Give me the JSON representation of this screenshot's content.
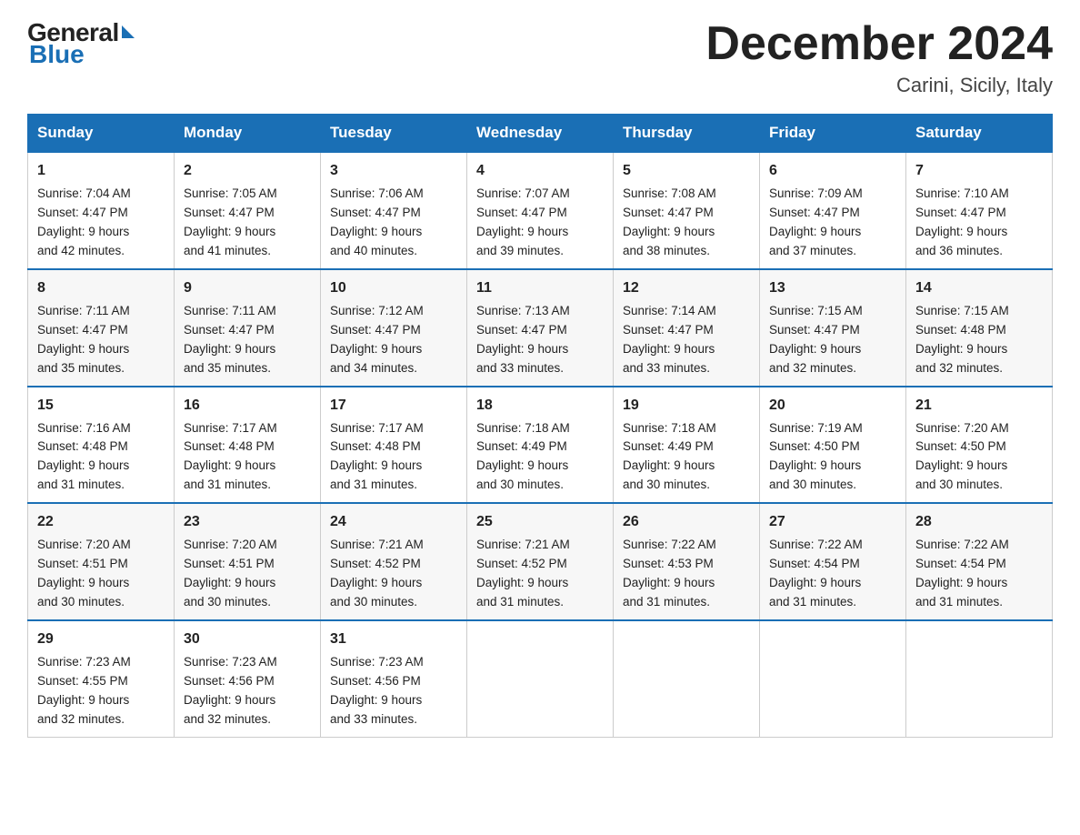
{
  "header": {
    "logo_general": "General",
    "logo_blue": "Blue",
    "month_title": "December 2024",
    "location": "Carini, Sicily, Italy"
  },
  "days_of_week": [
    "Sunday",
    "Monday",
    "Tuesday",
    "Wednesday",
    "Thursday",
    "Friday",
    "Saturday"
  ],
  "weeks": [
    [
      {
        "day": "1",
        "sunrise": "7:04 AM",
        "sunset": "4:47 PM",
        "daylight": "9 hours and 42 minutes."
      },
      {
        "day": "2",
        "sunrise": "7:05 AM",
        "sunset": "4:47 PM",
        "daylight": "9 hours and 41 minutes."
      },
      {
        "day": "3",
        "sunrise": "7:06 AM",
        "sunset": "4:47 PM",
        "daylight": "9 hours and 40 minutes."
      },
      {
        "day": "4",
        "sunrise": "7:07 AM",
        "sunset": "4:47 PM",
        "daylight": "9 hours and 39 minutes."
      },
      {
        "day": "5",
        "sunrise": "7:08 AM",
        "sunset": "4:47 PM",
        "daylight": "9 hours and 38 minutes."
      },
      {
        "day": "6",
        "sunrise": "7:09 AM",
        "sunset": "4:47 PM",
        "daylight": "9 hours and 37 minutes."
      },
      {
        "day": "7",
        "sunrise": "7:10 AM",
        "sunset": "4:47 PM",
        "daylight": "9 hours and 36 minutes."
      }
    ],
    [
      {
        "day": "8",
        "sunrise": "7:11 AM",
        "sunset": "4:47 PM",
        "daylight": "9 hours and 35 minutes."
      },
      {
        "day": "9",
        "sunrise": "7:11 AM",
        "sunset": "4:47 PM",
        "daylight": "9 hours and 35 minutes."
      },
      {
        "day": "10",
        "sunrise": "7:12 AM",
        "sunset": "4:47 PM",
        "daylight": "9 hours and 34 minutes."
      },
      {
        "day": "11",
        "sunrise": "7:13 AM",
        "sunset": "4:47 PM",
        "daylight": "9 hours and 33 minutes."
      },
      {
        "day": "12",
        "sunrise": "7:14 AM",
        "sunset": "4:47 PM",
        "daylight": "9 hours and 33 minutes."
      },
      {
        "day": "13",
        "sunrise": "7:15 AM",
        "sunset": "4:47 PM",
        "daylight": "9 hours and 32 minutes."
      },
      {
        "day": "14",
        "sunrise": "7:15 AM",
        "sunset": "4:48 PM",
        "daylight": "9 hours and 32 minutes."
      }
    ],
    [
      {
        "day": "15",
        "sunrise": "7:16 AM",
        "sunset": "4:48 PM",
        "daylight": "9 hours and 31 minutes."
      },
      {
        "day": "16",
        "sunrise": "7:17 AM",
        "sunset": "4:48 PM",
        "daylight": "9 hours and 31 minutes."
      },
      {
        "day": "17",
        "sunrise": "7:17 AM",
        "sunset": "4:48 PM",
        "daylight": "9 hours and 31 minutes."
      },
      {
        "day": "18",
        "sunrise": "7:18 AM",
        "sunset": "4:49 PM",
        "daylight": "9 hours and 30 minutes."
      },
      {
        "day": "19",
        "sunrise": "7:18 AM",
        "sunset": "4:49 PM",
        "daylight": "9 hours and 30 minutes."
      },
      {
        "day": "20",
        "sunrise": "7:19 AM",
        "sunset": "4:50 PM",
        "daylight": "9 hours and 30 minutes."
      },
      {
        "day": "21",
        "sunrise": "7:20 AM",
        "sunset": "4:50 PM",
        "daylight": "9 hours and 30 minutes."
      }
    ],
    [
      {
        "day": "22",
        "sunrise": "7:20 AM",
        "sunset": "4:51 PM",
        "daylight": "9 hours and 30 minutes."
      },
      {
        "day": "23",
        "sunrise": "7:20 AM",
        "sunset": "4:51 PM",
        "daylight": "9 hours and 30 minutes."
      },
      {
        "day": "24",
        "sunrise": "7:21 AM",
        "sunset": "4:52 PM",
        "daylight": "9 hours and 30 minutes."
      },
      {
        "day": "25",
        "sunrise": "7:21 AM",
        "sunset": "4:52 PM",
        "daylight": "9 hours and 31 minutes."
      },
      {
        "day": "26",
        "sunrise": "7:22 AM",
        "sunset": "4:53 PM",
        "daylight": "9 hours and 31 minutes."
      },
      {
        "day": "27",
        "sunrise": "7:22 AM",
        "sunset": "4:54 PM",
        "daylight": "9 hours and 31 minutes."
      },
      {
        "day": "28",
        "sunrise": "7:22 AM",
        "sunset": "4:54 PM",
        "daylight": "9 hours and 31 minutes."
      }
    ],
    [
      {
        "day": "29",
        "sunrise": "7:23 AM",
        "sunset": "4:55 PM",
        "daylight": "9 hours and 32 minutes."
      },
      {
        "day": "30",
        "sunrise": "7:23 AM",
        "sunset": "4:56 PM",
        "daylight": "9 hours and 32 minutes."
      },
      {
        "day": "31",
        "sunrise": "7:23 AM",
        "sunset": "4:56 PM",
        "daylight": "9 hours and 33 minutes."
      },
      null,
      null,
      null,
      null
    ]
  ],
  "labels": {
    "sunrise": "Sunrise:",
    "sunset": "Sunset:",
    "daylight": "Daylight:"
  }
}
